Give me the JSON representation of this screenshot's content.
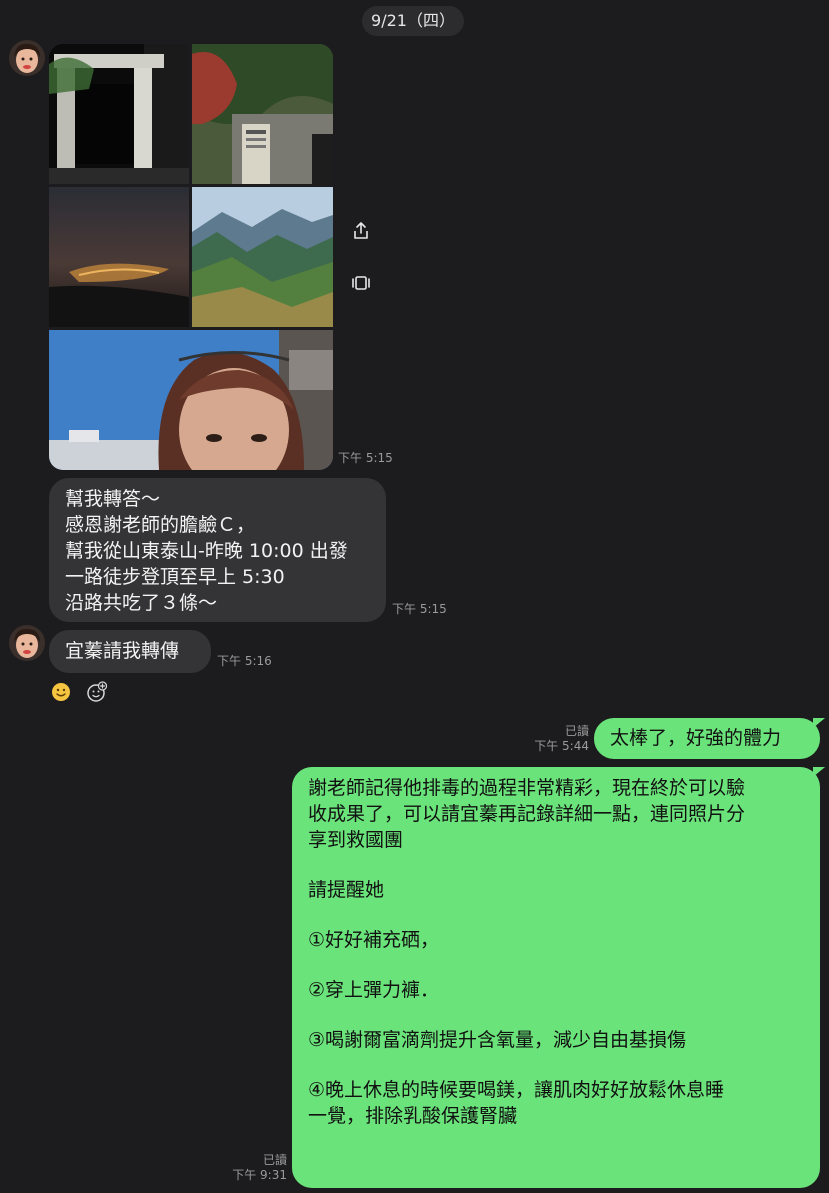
{
  "date_divider": "9/21（四）",
  "message_photos": {
    "time": "下午 5:15",
    "photo_names": [
      "photo-gate-night",
      "photo-trail-rock",
      "photo-city-lights-night",
      "photo-mountain-ridges",
      "photo-selfie-sky"
    ]
  },
  "message_text_1": {
    "lines": [
      "幫我轉答～",
      "感恩謝老師的膽鹼Ｃ，",
      "幫我從山東泰山-昨晚 10:00 出發",
      "一路徒步登頂至早上 5:30",
      "沿路共吃了３條～"
    ],
    "time": "下午 5:15"
  },
  "message_text_2": {
    "text": "宜蓁請我轉傳",
    "time": "下午 5:16"
  },
  "reply_1": {
    "read": "已讀",
    "time": "下午 5:44",
    "text": "太棒了，好強的體力"
  },
  "reply_2": {
    "read": "已讀",
    "time": "下午 9:31",
    "lines": [
      "謝老師記得他排毒的過程非常精彩，現在終於可以驗",
      "收成果了，可以請宜蓁再記錄詳細一點，連同照片分",
      "享到救國團",
      "",
      "請提醒她",
      "",
      "①好好補充硒，",
      "",
      "②穿上彈力褲．",
      "",
      "③喝謝爾富滴劑提升含氧量，減少自由基損傷",
      "",
      "④晚上休息的時候要喝鎂，讓肌肉好好放鬆休息睡",
      "一覺，排除乳酸保護腎臟"
    ]
  },
  "icons": {
    "share": "share-icon",
    "gallery": "gallery-icon",
    "reaction": "smile-reaction-icon",
    "add_reaction": "add-reaction-icon"
  },
  "colors": {
    "background": "#1c1c1e",
    "incoming_bubble": "#343436",
    "outgoing_bubble": "#6ae37a"
  }
}
